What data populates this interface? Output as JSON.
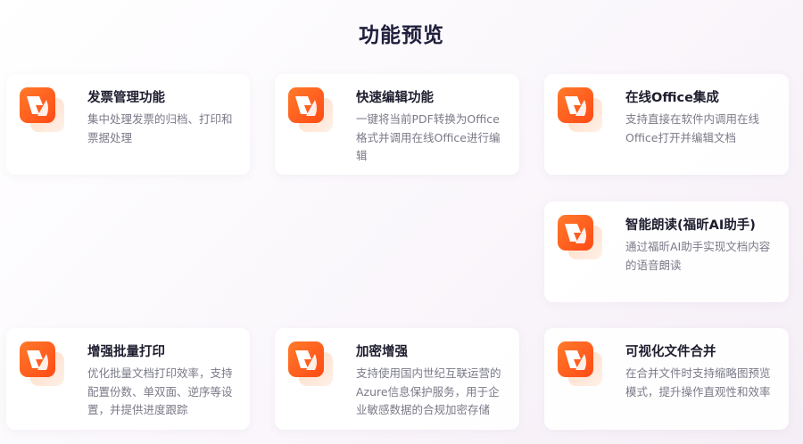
{
  "page": {
    "title": "功能预览"
  },
  "features": [
    {
      "title": "发票管理功能",
      "desc": "集中处理发票的归档、打印和票据处理",
      "icon": "foxit-logo-icon"
    },
    {
      "title": "快速编辑功能",
      "desc": "一键将当前PDF转换为Office格式并调用在线Office进行编辑",
      "icon": "foxit-logo-icon"
    },
    {
      "title": "在线Office集成",
      "desc": "支持直接在软件内调用在线Office打开并编辑文档",
      "icon": "foxit-logo-icon"
    },
    {
      "title": "智能朗读(福昕AI助手)",
      "desc": "通过福昕AI助手实现文档内容的语音朗读",
      "icon": "foxit-logo-icon"
    },
    {
      "title": "增强批量打印",
      "desc": "优化批量文档打印效率，支持配置份数、单双面、逆序等设置，并提供进度跟踪",
      "icon": "foxit-logo-icon"
    },
    {
      "title": "加密增强",
      "desc": "支持使用国内世纪互联运营的Azure信息保护服务，用于企业敏感数据的合规加密存储",
      "icon": "foxit-logo-icon"
    },
    {
      "title": "可视化文件合并",
      "desc": "在合并文件时支持缩略图预览模式，提升操作直观性和效率",
      "icon": "foxit-logo-icon"
    }
  ],
  "colors": {
    "brand_orange": "#ff5a1f",
    "brand_orange_light": "#ff8a3d",
    "title": "#1f1f3d",
    "desc": "#7a7a88"
  }
}
